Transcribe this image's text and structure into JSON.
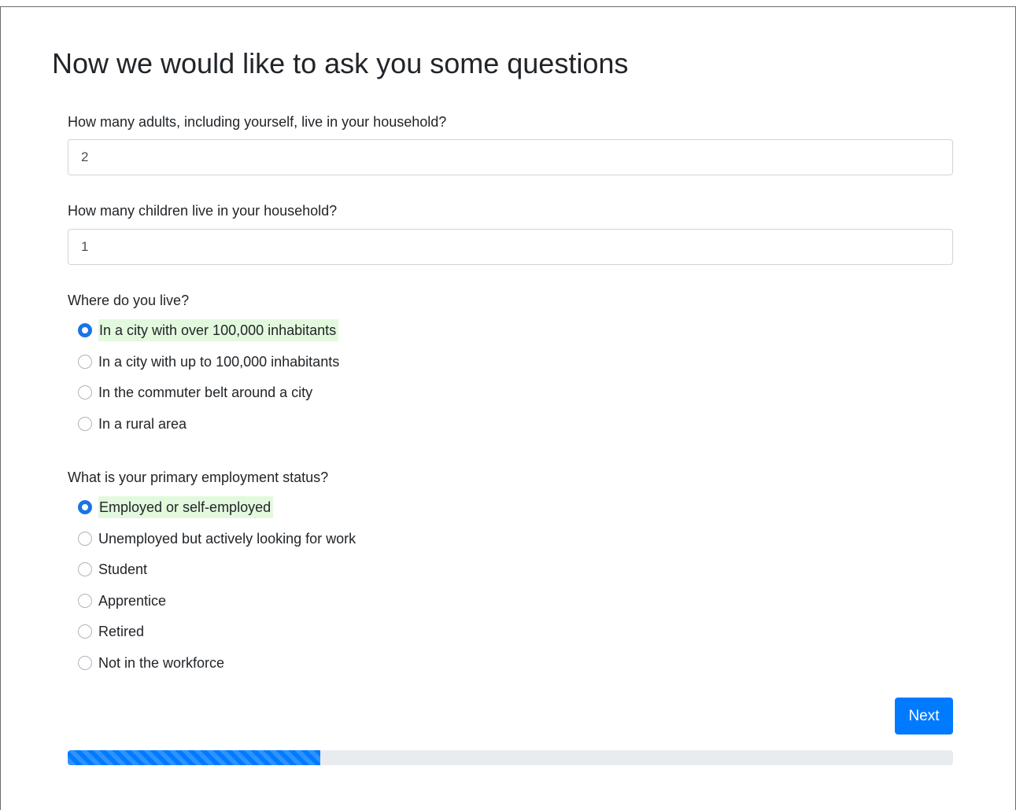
{
  "page": {
    "title": "Now we would like to ask you some questions"
  },
  "questions": {
    "adults": {
      "label": "How many adults, including yourself, live in your household?",
      "value": "2"
    },
    "children": {
      "label": "How many children live in your household?",
      "value": "1"
    },
    "residence": {
      "label": "Where do you live?",
      "options": [
        "In a city with over 100,000 inhabitants",
        "In a city with up to 100,000 inhabitants",
        "In the commuter belt around a city",
        "In a rural area"
      ],
      "selected_index": 0
    },
    "employment": {
      "label": "What is your primary employment status?",
      "options": [
        "Employed or self-employed",
        "Unemployed but actively looking for work",
        "Student",
        "Apprentice",
        "Retired",
        "Not in the workforce"
      ],
      "selected_index": 0
    }
  },
  "actions": {
    "next_label": "Next"
  },
  "progress": {
    "fraction": 0.285
  },
  "colors": {
    "accent": "#007bff",
    "selected_highlight": "#e3f9de",
    "progress_track": "#e9ecef"
  }
}
